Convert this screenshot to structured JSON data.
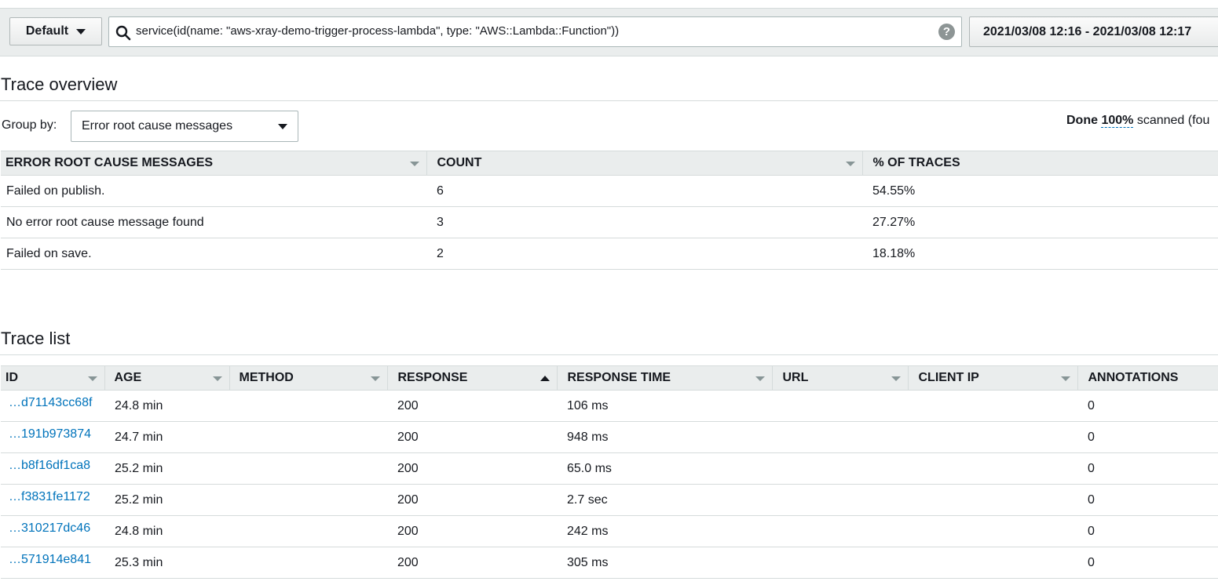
{
  "toolbar": {
    "group_button_label": "Default",
    "query": "service(id(name: \"aws-xray-demo-trigger-process-lambda\", type: \"AWS::Lambda::Function\"))",
    "help_glyph": "?",
    "time_range": "2021/03/08 12:16 - 2021/03/08 12:17"
  },
  "overview": {
    "title": "Trace overview",
    "group_by_label": "Group by:",
    "group_by_value": "Error root cause messages",
    "scan_status": {
      "done": "Done",
      "percent": "100%",
      "rest": "scanned (fou"
    },
    "columns": [
      "ERROR ROOT CAUSE MESSAGES",
      "COUNT",
      "% OF TRACES"
    ],
    "rows": [
      [
        "Failed on publish.",
        "6",
        "54.55%"
      ],
      [
        "No error root cause message found",
        "3",
        "27.27%"
      ],
      [
        "Failed on save.",
        "2",
        "18.18%"
      ]
    ]
  },
  "trace_list": {
    "title": "Trace list",
    "columns": [
      "ID",
      "AGE",
      "METHOD",
      "RESPONSE",
      "RESPONSE TIME",
      "URL",
      "CLIENT IP",
      "ANNOTATIONS"
    ],
    "rows": [
      [
        "…d71143cc68f",
        "24.8 min",
        "",
        "200",
        "106 ms",
        "",
        "",
        "0"
      ],
      [
        "…191b973874",
        "24.7 min",
        "",
        "200",
        "948 ms",
        "",
        "",
        "0"
      ],
      [
        "…b8f16df1ca8",
        "25.2 min",
        "",
        "200",
        "65.0 ms",
        "",
        "",
        "0"
      ],
      [
        "…f3831fe1172",
        "25.2 min",
        "",
        "200",
        "2.7 sec",
        "",
        "",
        "0"
      ],
      [
        "…310217dc46",
        "24.8 min",
        "",
        "200",
        "242 ms",
        "",
        "",
        "0"
      ],
      [
        "…571914e841",
        "25.3 min",
        "",
        "200",
        "305 ms",
        "",
        "",
        "0"
      ]
    ]
  },
  "icons": {
    "search": "search-icon",
    "help": "help-icon",
    "dropdown": "chevron-down-icon",
    "sort_asc": "sort-ascending-icon"
  }
}
